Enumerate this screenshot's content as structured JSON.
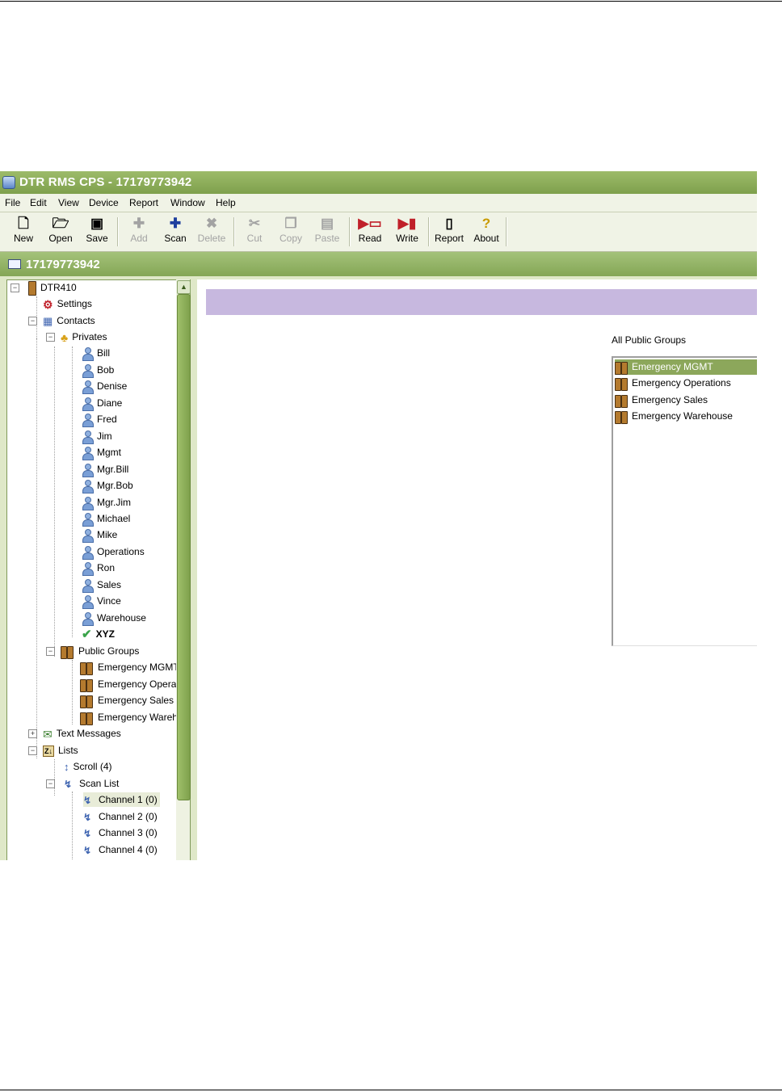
{
  "window": {
    "title": "DTR RMS CPS - 17179773942"
  },
  "menu": [
    "File",
    "Edit",
    "View",
    "Device",
    "Report",
    "Window",
    "Help"
  ],
  "toolbar": {
    "new": "New",
    "open": "Open",
    "save": "Save",
    "add": "Add",
    "scan": "Scan",
    "delete": "Delete",
    "cut": "Cut",
    "copy": "Copy",
    "paste": "Paste",
    "read": "Read",
    "write": "Write",
    "report": "Report",
    "about": "About"
  },
  "document": {
    "title": "17179773942"
  },
  "tree": {
    "root": "DTR410",
    "settings": "Settings",
    "contacts": "Contacts",
    "privates": "Privates",
    "private_contacts": [
      "Bill",
      "Bob",
      "Denise",
      "Diane",
      "Fred",
      "Jim",
      "Mgmt",
      "Mgr.Bill",
      "Mgr.Bob",
      "Mgr.Jim",
      "Michael",
      "Mike",
      "Operations",
      "Ron",
      "Sales",
      "Vince",
      "Warehouse"
    ],
    "xyz": "XYZ",
    "public_groups": "Public Groups",
    "public_group_items": [
      "Emergency MGMT",
      "Emergency Operations",
      "Emergency Sales",
      "Emergency Warehouse"
    ],
    "text_messages": "Text Messages",
    "lists": "Lists",
    "scroll": "Scroll (4)",
    "scan_list": "Scan List",
    "channels": [
      "Channel 1 (0)",
      "Channel 2 (0)",
      "Channel 3 (0)",
      "Channel 4 (0)"
    ]
  },
  "panel": {
    "all_public_groups_label": "All Public Groups",
    "groups": [
      "Emergency MGMT",
      "Emergency Operations",
      "Emergency Sales",
      "Emergency Warehouse"
    ],
    "selected": "Emergency MGMT"
  },
  "colors": {
    "title_green": "#7ea04c",
    "banner_lavender": "#c7b8df",
    "selection_green": "#8ca75b"
  }
}
